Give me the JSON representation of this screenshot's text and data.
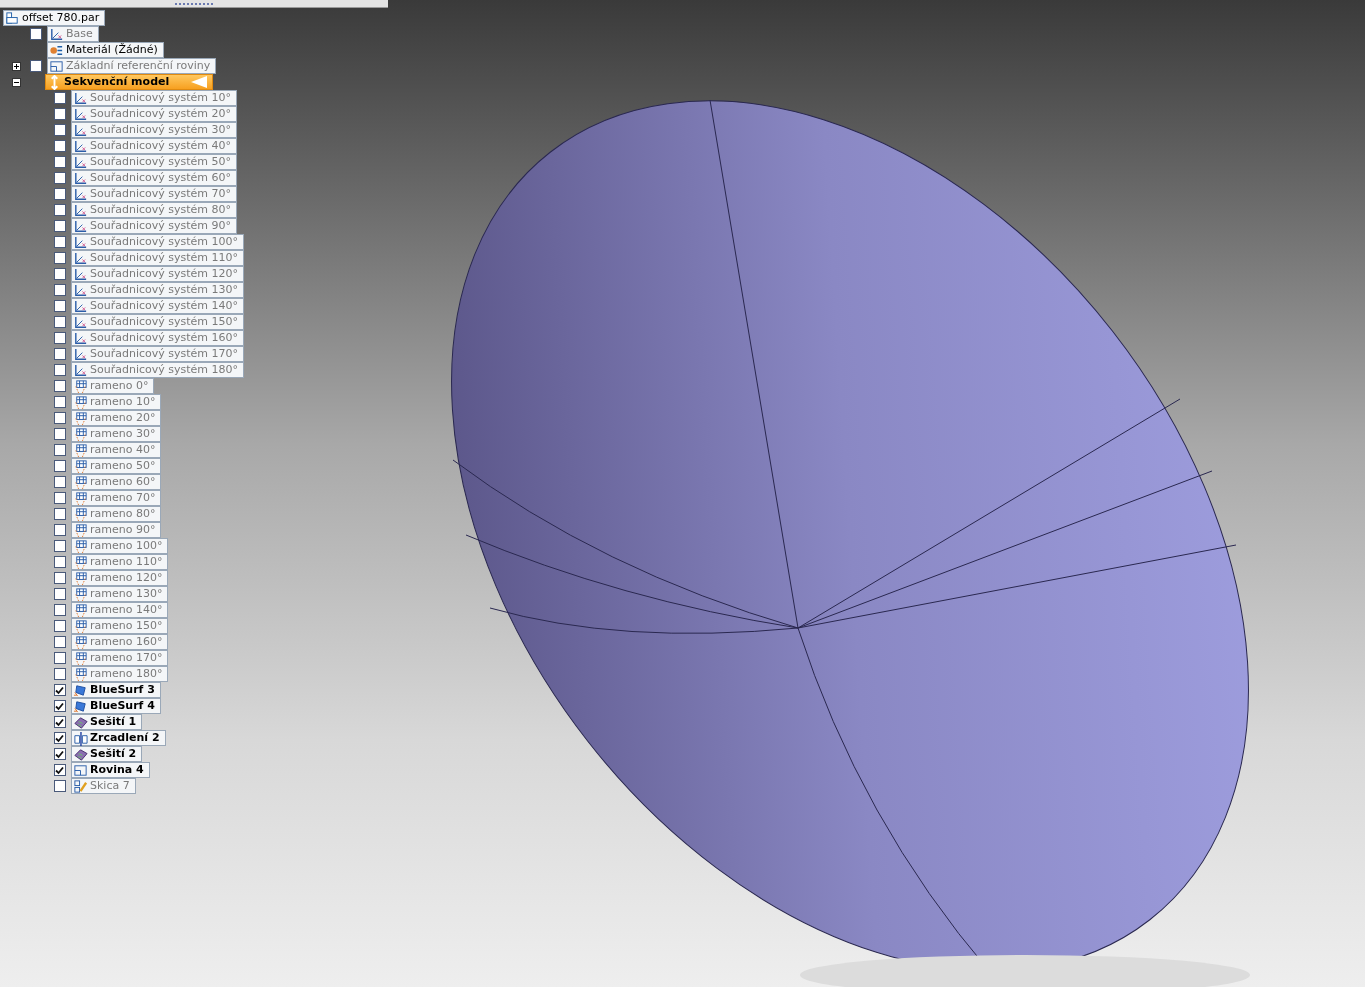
{
  "tree": {
    "label": "offset 780.par",
    "kind": "part",
    "children": [
      {
        "label": "Base",
        "kind": "base",
        "checked": false
      },
      {
        "label": "Materiál (Žádné)",
        "kind": "material"
      },
      {
        "label": "Základní referenční roviny",
        "kind": "refplanes",
        "checked": false,
        "expanded": false
      },
      {
        "label": "Sekvenční model",
        "kind": "model",
        "expanded": true,
        "selected": true,
        "children": [
          {
            "label": "Souřadnicový systém 10°",
            "kind": "coordsys",
            "checked": false
          },
          {
            "label": "Souřadnicový systém 20°",
            "kind": "coordsys",
            "checked": false
          },
          {
            "label": "Souřadnicový systém 30°",
            "kind": "coordsys",
            "checked": false
          },
          {
            "label": "Souřadnicový systém 40°",
            "kind": "coordsys",
            "checked": false
          },
          {
            "label": "Souřadnicový systém 50°",
            "kind": "coordsys",
            "checked": false
          },
          {
            "label": "Souřadnicový systém 60°",
            "kind": "coordsys",
            "checked": false
          },
          {
            "label": "Souřadnicový systém 70°",
            "kind": "coordsys",
            "checked": false
          },
          {
            "label": "Souřadnicový systém 80°",
            "kind": "coordsys",
            "checked": false
          },
          {
            "label": "Souřadnicový systém 90°",
            "kind": "coordsys",
            "checked": false
          },
          {
            "label": "Souřadnicový systém 100°",
            "kind": "coordsys",
            "checked": false
          },
          {
            "label": "Souřadnicový systém 110°",
            "kind": "coordsys",
            "checked": false
          },
          {
            "label": "Souřadnicový systém 120°",
            "kind": "coordsys",
            "checked": false
          },
          {
            "label": "Souřadnicový systém 130°",
            "kind": "coordsys",
            "checked": false
          },
          {
            "label": "Souřadnicový systém 140°",
            "kind": "coordsys",
            "checked": false
          },
          {
            "label": "Souřadnicový systém 150°",
            "kind": "coordsys",
            "checked": false
          },
          {
            "label": "Souřadnicový systém 160°",
            "kind": "coordsys",
            "checked": false
          },
          {
            "label": "Souřadnicový systém 170°",
            "kind": "coordsys",
            "checked": false
          },
          {
            "label": "Souřadnicový systém 180°",
            "kind": "coordsys",
            "checked": false
          },
          {
            "label": "rameno 0°",
            "kind": "arm",
            "checked": false
          },
          {
            "label": "rameno 10°",
            "kind": "arm",
            "checked": false
          },
          {
            "label": "rameno 20°",
            "kind": "arm",
            "checked": false
          },
          {
            "label": "rameno 30°",
            "kind": "arm",
            "checked": false
          },
          {
            "label": "rameno 40°",
            "kind": "arm",
            "checked": false
          },
          {
            "label": "rameno 50°",
            "kind": "arm",
            "checked": false
          },
          {
            "label": "rameno 60°",
            "kind": "arm",
            "checked": false
          },
          {
            "label": "rameno 70°",
            "kind": "arm",
            "checked": false
          },
          {
            "label": "rameno 80°",
            "kind": "arm",
            "checked": false
          },
          {
            "label": "rameno 90°",
            "kind": "arm",
            "checked": false
          },
          {
            "label": "rameno 100°",
            "kind": "arm",
            "checked": false
          },
          {
            "label": "rameno 110°",
            "kind": "arm",
            "checked": false
          },
          {
            "label": "rameno 120°",
            "kind": "arm",
            "checked": false
          },
          {
            "label": "rameno 130°",
            "kind": "arm",
            "checked": false
          },
          {
            "label": "rameno 140°",
            "kind": "arm",
            "checked": false
          },
          {
            "label": "rameno 150°",
            "kind": "arm",
            "checked": false
          },
          {
            "label": "rameno 160°",
            "kind": "arm",
            "checked": false
          },
          {
            "label": "rameno 170°",
            "kind": "arm",
            "checked": false
          },
          {
            "label": "rameno 180°",
            "kind": "arm",
            "checked": false
          },
          {
            "label": "BlueSurf 3",
            "kind": "surface",
            "checked": true
          },
          {
            "label": "BlueSurf 4",
            "kind": "surface",
            "checked": true
          },
          {
            "label": "Sešití 1",
            "kind": "stitch",
            "checked": true
          },
          {
            "label": "Zrcadlení 2",
            "kind": "mirror",
            "checked": true
          },
          {
            "label": "Sešití 2",
            "kind": "stitch",
            "checked": true
          },
          {
            "label": "Rovina 4",
            "kind": "plane",
            "checked": true
          },
          {
            "label": "Skica 7",
            "kind": "sketch",
            "checked": false
          }
        ]
      }
    ]
  }
}
